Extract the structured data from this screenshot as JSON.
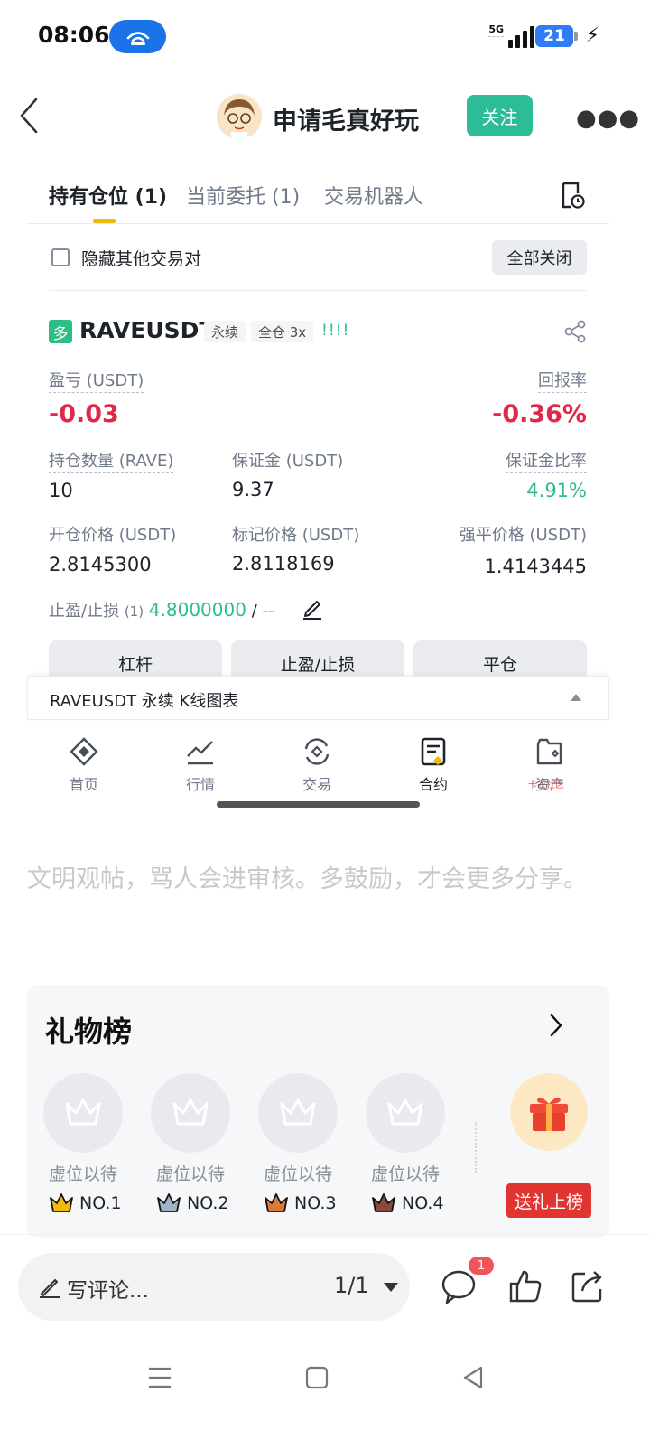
{
  "status_bar": {
    "time": "08:06",
    "network": "5G",
    "battery": "21"
  },
  "header": {
    "title": "申请毛真好玩",
    "follow_label": "关注"
  },
  "tabs": [
    {
      "label": "持有仓位 (1)",
      "active": true
    },
    {
      "label": "当前委托 (1)",
      "active": false
    },
    {
      "label": "交易机器人",
      "active": false
    }
  ],
  "filter": {
    "hide_label": "隐藏其他交易对",
    "close_all_label": "全部关闭"
  },
  "position": {
    "side_badge": "多",
    "symbol": "RAVEUSDT",
    "type_tag": "永续",
    "margin_tag": "全仓 3x",
    "signal": "!!!!",
    "pnl_label": "盈亏 (USDT)",
    "pnl_value": "-0.03",
    "roe_label": "回报率",
    "roe_value": "-0.36%",
    "size_label": "持仓数量 (RAVE)",
    "size_value": "10",
    "margin_label": "保证金 (USDT)",
    "margin_value": "9.37",
    "margin_ratio_label": "保证金比率",
    "margin_ratio_value": "4.91%",
    "entry_label": "开仓价格 (USDT)",
    "entry_value": "2.8145300",
    "mark_label": "标记价格 (USDT)",
    "mark_value": "2.8118169",
    "liq_label": "强平价格 (USDT)",
    "liq_value": "1.4143445",
    "tpsl_label": "止盈/止损",
    "tpsl_count": "(1)",
    "tp_value": "4.8000000",
    "sl_sep": "/",
    "sl_value": "--",
    "buttons": {
      "leverage": "杠杆",
      "tpsl": "止盈/止损",
      "close": "平仓"
    }
  },
  "kline_bar": {
    "label": "RAVEUSDT 永续 K线图表"
  },
  "app_nav": [
    {
      "label": "首页",
      "icon": "home-diamond-icon"
    },
    {
      "label": "行情",
      "icon": "chart-trend-icon"
    },
    {
      "label": "交易",
      "icon": "exchange-icon"
    },
    {
      "label": "合约",
      "icon": "futures-doc-icon",
      "active": true
    },
    {
      "label": "资产",
      "icon": "wallet-icon"
    }
  ],
  "watermark": "卡农社区",
  "notice": "文明观帖，骂人会进审核。多鼓励，才会更多分享。",
  "gift_board": {
    "title": "礼物榜",
    "seats": [
      {
        "label": "虚位以待",
        "rank": "NO.1",
        "color": "#f0b90b"
      },
      {
        "label": "虚位以待",
        "rank": "NO.2",
        "color": "#9fb3c8"
      },
      {
        "label": "虚位以待",
        "rank": "NO.3",
        "color": "#d9793a"
      },
      {
        "label": "虚位以待",
        "rank": "NO.4",
        "color": "#8a4a3a"
      }
    ],
    "send_label": "送礼上榜"
  },
  "comment_bar": {
    "placeholder": "写评论...",
    "page": "1/1",
    "comment_badge": "1"
  }
}
